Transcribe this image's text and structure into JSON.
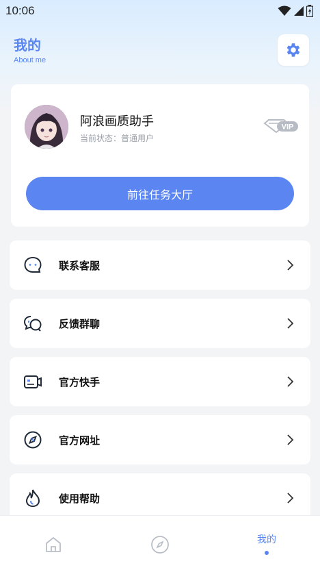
{
  "status_bar": {
    "time": "10:06"
  },
  "header": {
    "title": "我的",
    "subtitle": "About me"
  },
  "settings": {
    "icon": "gear-icon"
  },
  "profile": {
    "username": "阿浪画质助手",
    "status": "当前状态：普通用户",
    "badge": "VIP",
    "task_button": "前往任务大厅"
  },
  "menu": [
    {
      "label": "联系客服",
      "icon": "chat-bubble-icon"
    },
    {
      "label": "反馈群聊",
      "icon": "group-chat-icon"
    },
    {
      "label": "官方快手",
      "icon": "video-camera-icon"
    },
    {
      "label": "官方网址",
      "icon": "compass-icon"
    },
    {
      "label": "使用帮助",
      "icon": "flame-icon"
    }
  ],
  "bottom_nav": {
    "items": [
      {
        "icon": "home-icon"
      },
      {
        "icon": "compass-icon"
      },
      {
        "label": "我的"
      }
    ],
    "active_index": 2
  },
  "colors": {
    "accent": "#5b86f2",
    "background": "#f3f4f6",
    "card": "#ffffff"
  }
}
